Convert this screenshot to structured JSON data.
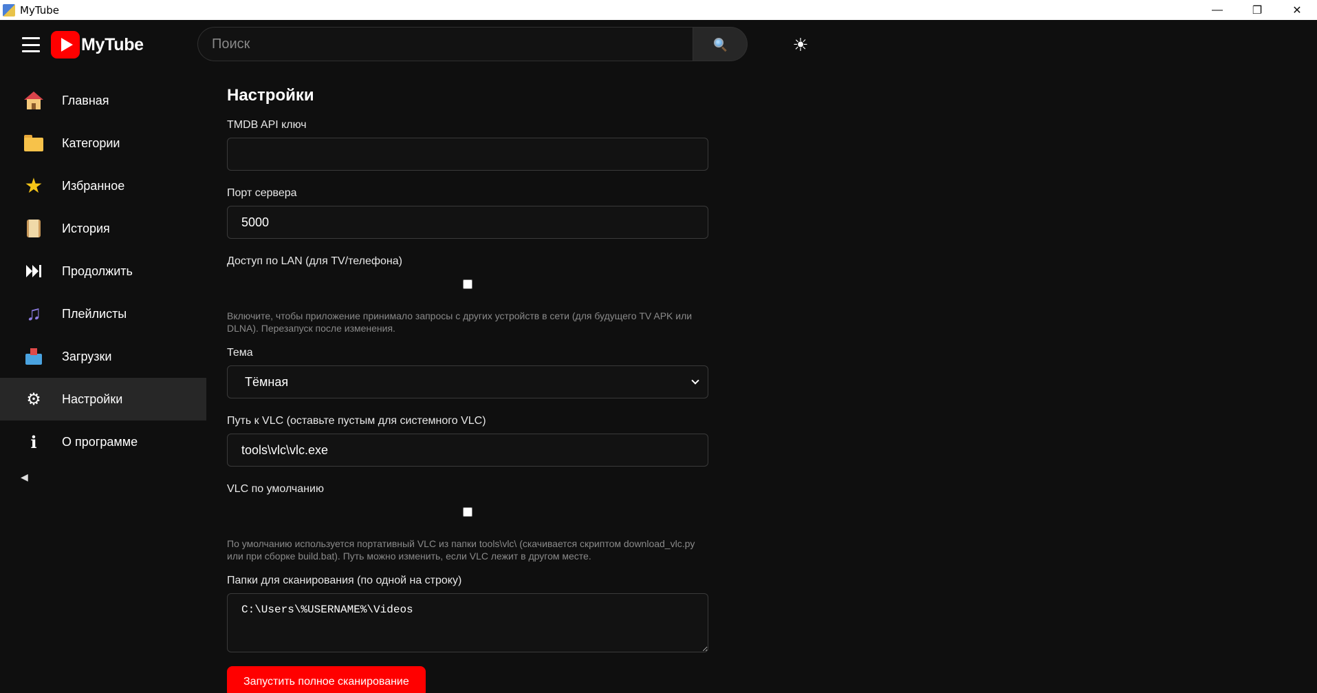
{
  "window": {
    "title": "MyTube"
  },
  "header": {
    "logo_text": "MyTube",
    "search": {
      "placeholder": "Поиск",
      "value": ""
    },
    "theme_icon": "☀"
  },
  "sidebar": {
    "items": [
      {
        "label": "Главная",
        "icon": "home-icon",
        "active": false
      },
      {
        "label": "Категории",
        "icon": "folder-icon",
        "active": false
      },
      {
        "label": "Избранное",
        "icon": "star-icon",
        "active": false
      },
      {
        "label": "История",
        "icon": "scroll-icon",
        "active": false
      },
      {
        "label": "Продолжить",
        "icon": "next-track-icon",
        "active": false
      },
      {
        "label": "Плейлисты",
        "icon": "music-note-icon",
        "active": false
      },
      {
        "label": "Загрузки",
        "icon": "inbox-icon",
        "active": false
      },
      {
        "label": "Настройки",
        "icon": "gear-icon",
        "active": true
      },
      {
        "label": "О программе",
        "icon": "info-icon",
        "active": false
      }
    ],
    "collapse_icon": "◀"
  },
  "settings": {
    "title": "Настройки",
    "tmdb": {
      "label": "TMDB API ключ",
      "value": ""
    },
    "port": {
      "label": "Порт сервера",
      "value": "5000"
    },
    "lan": {
      "label": "Доступ по LAN (для TV/телефона)",
      "checked": false,
      "hint": "Включите, чтобы приложение принимало запросы с других устройств в сети (для будущего TV APK или DLNA). Перезапуск после изменения."
    },
    "theme": {
      "label": "Тема",
      "selected": "Тёмная"
    },
    "vlc_path": {
      "label": "Путь к VLC (оставьте пустым для системного VLC)",
      "value": "tools\\vlc\\vlc.exe"
    },
    "vlc_default": {
      "label": "VLC по умолчанию",
      "checked": false,
      "hint": "По умолчанию используется портативный VLC из папки tools\\vlc\\ (скачивается скриптом download_vlc.py или при сборке build.bat). Путь можно изменить, если VLC лежит в другом месте."
    },
    "scan_folders": {
      "label": "Папки для сканирования (по одной на строку)",
      "value": "C:\\Users\\%USERNAME%\\Videos"
    },
    "scan_button": "Запустить полное сканирование"
  },
  "colors": {
    "accent": "#ff0000",
    "background": "#0f0f0f",
    "active_item": "#272727"
  }
}
